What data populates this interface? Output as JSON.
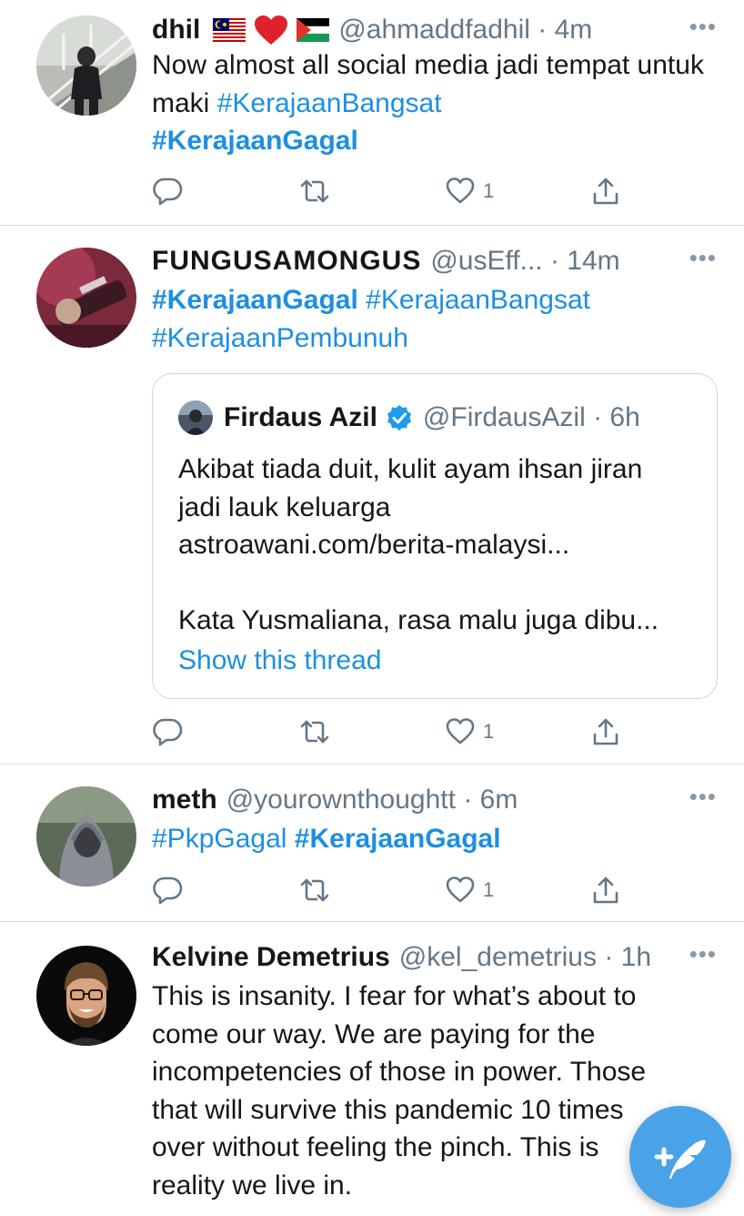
{
  "tweets": [
    {
      "name": "dhil",
      "flags": [
        "malaysia-flag",
        "red-heart",
        "palestine-flag"
      ],
      "handle": "@ahmaddfadhil",
      "time": "· 4m",
      "text": "Now almost all social media jadi tempat untuk maki ",
      "tags": [
        {
          "text": "#KerajaanBangsat",
          "bold": false
        },
        {
          "text": "#KerajaanGagal",
          "bold": true
        }
      ],
      "likes": "1"
    },
    {
      "name": "FUNGUSAMONGUS",
      "handle": "@usEff...",
      "time": "· 14m",
      "tags": [
        {
          "text": "#KerajaanGagal",
          "bold": true
        },
        {
          "text": "#KerajaanBangsat",
          "bold": false
        },
        {
          "text": "#KerajaanPembunuh",
          "bold": false
        }
      ],
      "likes": "1",
      "quote": {
        "name": "Firdaus Azil",
        "handle": "@FirdausAzil",
        "time": "· 6h",
        "line1": "Akibat tiada duit, kulit ayam ihsan jiran",
        "line2": "jadi lauk keluarga",
        "line3": "astroawani.com/berita-malaysi...",
        "line4": "Kata Yusmaliana, rasa malu juga dibu...",
        "show_thread": "Show this thread"
      }
    },
    {
      "name": "meth",
      "handle": "@yourownthoughtt",
      "time": "· 6m",
      "tags": [
        {
          "text": "#PkpGagal",
          "bold": false
        },
        {
          "text": "#KerajaanGagal",
          "bold": true
        }
      ],
      "likes": "1"
    },
    {
      "name": "Kelvine Demetrius",
      "handle": "@kel_demetrius",
      "time": "· 1h",
      "lines": [
        "This is insanity. I fear for what’s about to",
        "come our way. We are paying for the",
        "incompetencies of those in power. Those",
        "that will survive this pandemic 10 times",
        "over without feeling the pinch. This is",
        "reality we live in."
      ]
    }
  ],
  "more_label": "•••",
  "colors": {
    "accent": "#1d8fe0",
    "fab": "#4aa3e8",
    "secondary_text": "#657786",
    "divider": "#dadde1"
  },
  "icons": {
    "reply": "reply-icon",
    "retweet": "retweet-icon",
    "like": "like-icon",
    "share": "share-icon",
    "compose": "compose-tweet-icon",
    "verified": "verified-badge-icon"
  }
}
